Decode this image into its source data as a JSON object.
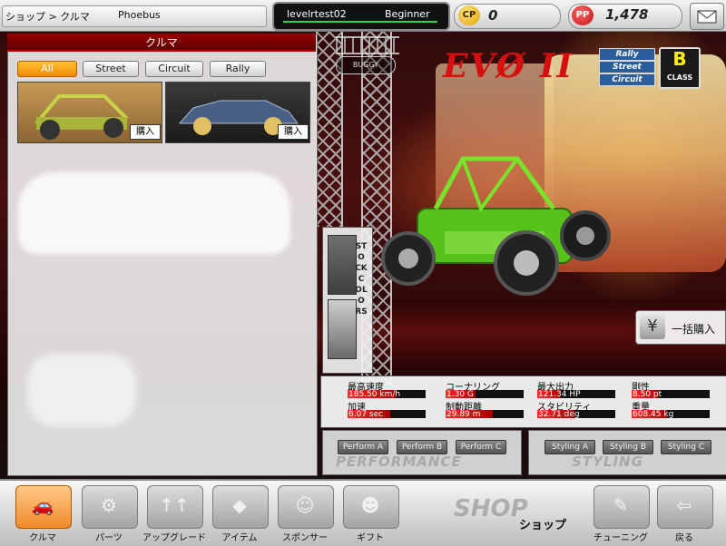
{
  "topbar": {
    "breadcrumb": "ショップ > クルマ",
    "player_name": "Phoebus",
    "user_id": "levelrtest02",
    "user_rank": "Beginner",
    "cp_icon": "CP",
    "cp_value": "0",
    "pp_icon": "PP",
    "pp_value": "1,478",
    "mail_icon": "mail-icon"
  },
  "car_panel": {
    "title": "クルマ",
    "filters": [
      "All",
      "Street",
      "Circuit",
      "Rally"
    ],
    "active_filter": "All",
    "items": [
      {
        "buy_label": "購入"
      },
      {
        "buy_label": "購入"
      }
    ]
  },
  "car": {
    "name": "EVØ II",
    "logo": "BUGGY",
    "modes": [
      "Rally",
      "Street",
      "Circuit"
    ],
    "class_letter": "B",
    "class_label": "CLASS",
    "stock_colors_label": "STOCKCOLORS",
    "bulk_buy_label": "一括購入",
    "bulk_buy_icon": "¥"
  },
  "stats": {
    "top_speed": {
      "label": "最高速度",
      "value": "185.50 km/h",
      "fraction": 0.62
    },
    "accel": {
      "label": "加速",
      "value": "6.07 sec",
      "fraction": 0.55
    },
    "cornering": {
      "label": "コーナリング",
      "value": "1.30 G",
      "fraction": 0.38
    },
    "braking": {
      "label": "制動距離",
      "value": "29.89 m",
      "fraction": 0.6
    },
    "max_power": {
      "label": "最大出力",
      "value": "121.34 HP",
      "fraction": 0.3
    },
    "stability": {
      "label": "スタビリティ",
      "value": "32.71 deg",
      "fraction": 0.48
    },
    "rigidity": {
      "label": "剛性",
      "value": "8.50 pt",
      "fraction": 0.35
    },
    "weight": {
      "label": "重量",
      "value": "608.45 kg",
      "fraction": 0.45
    }
  },
  "perform": {
    "slots": [
      "Perform A",
      "Perform B",
      "Perform C"
    ],
    "watermark": "PERFORMANCE"
  },
  "styling": {
    "slots": [
      "Styling A",
      "Styling B",
      "Styling C"
    ],
    "watermark": "STYLING"
  },
  "bottom_nav": {
    "items": [
      {
        "label": "クルマ",
        "icon": "car-icon",
        "glyph": "🚗"
      },
      {
        "label": "パーツ",
        "icon": "parts-icon",
        "glyph": "⚙"
      },
      {
        "label": "アップグレード",
        "icon": "upgrade-icon",
        "glyph": "↑↑"
      },
      {
        "label": "アイテム",
        "icon": "item-icon",
        "glyph": "◆"
      },
      {
        "label": "スポンサー",
        "icon": "sponsor-icon",
        "glyph": "☺"
      },
      {
        "label": "ギフト",
        "icon": "gift-icon",
        "glyph": "☻"
      },
      {
        "label": "チューニング",
        "icon": "wrench-icon",
        "glyph": "✎"
      },
      {
        "label": "戻る",
        "icon": "exit-icon",
        "glyph": "⇦"
      }
    ],
    "shop_logo": "SHOP",
    "shop_caption": "ショップ"
  },
  "colors": {
    "accent": "#f08a00",
    "stat_bar": "#ff2a2a",
    "panel_header": "#9b0000"
  }
}
